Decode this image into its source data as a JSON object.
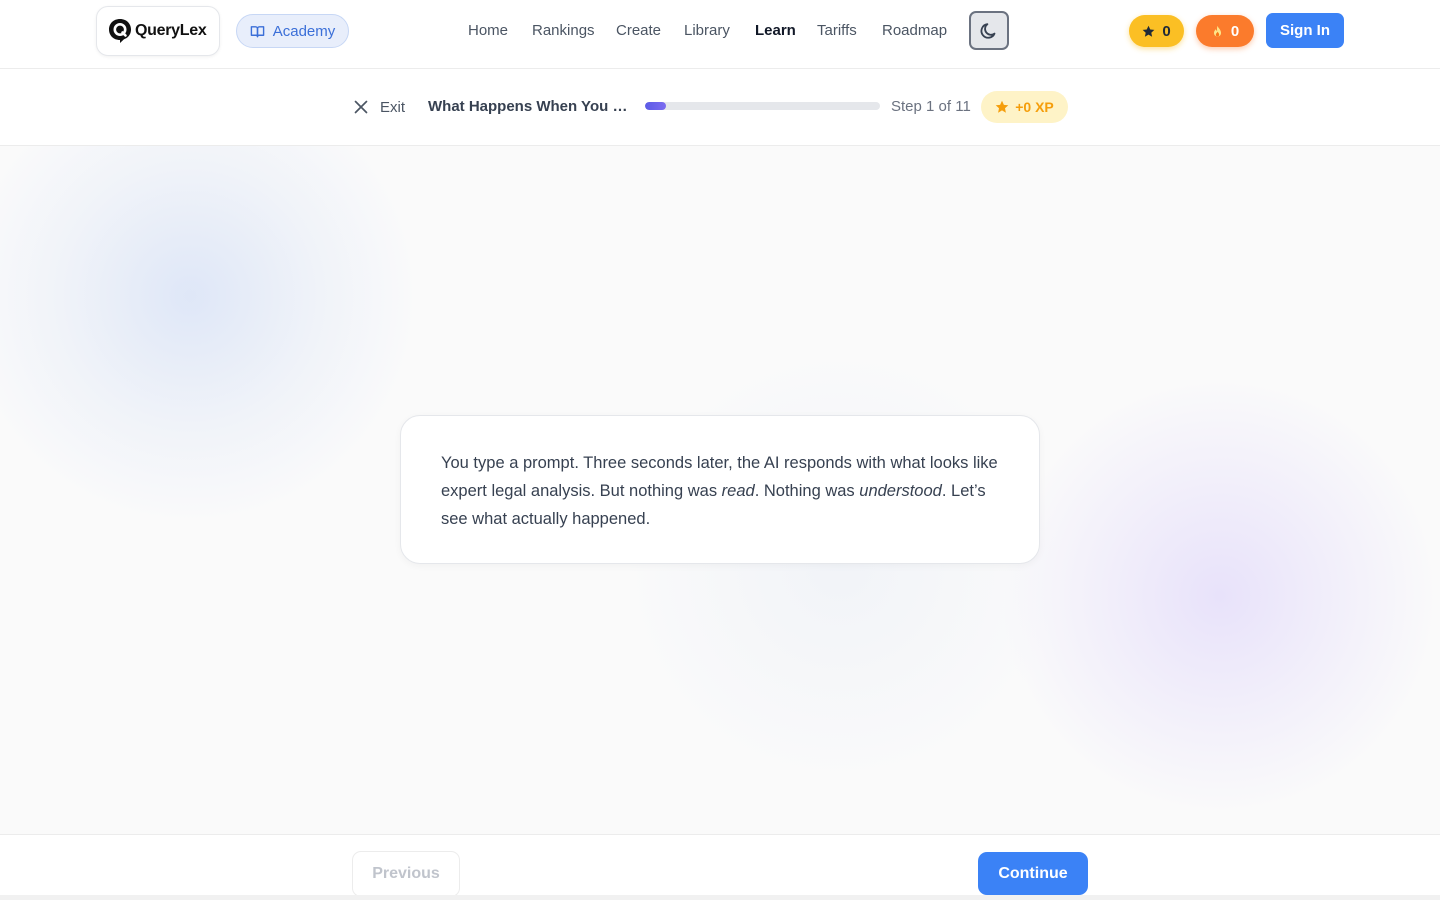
{
  "brand": {
    "name": "QueryLex",
    "logo_icon": "chat-bubble-q-icon"
  },
  "header": {
    "academy_label": "Academy",
    "nav": [
      {
        "label": "Home",
        "active": false
      },
      {
        "label": "Rankings",
        "active": false
      },
      {
        "label": "Create",
        "active": false
      },
      {
        "label": "Library",
        "active": false
      },
      {
        "label": "Learn",
        "active": true
      },
      {
        "label": "Tariffs",
        "active": false
      },
      {
        "label": "Roadmap",
        "active": false
      }
    ],
    "theme_icon": "moon-icon",
    "stars_count": "0",
    "streak_count": "0",
    "signin_label": "Sign In"
  },
  "lesson": {
    "exit_label": "Exit",
    "title": "What Happens When You T...",
    "progress_fraction": 0.09,
    "step_label": "Step 1 of 11",
    "xp_label": "+0 XP",
    "body_part1": "You type a prompt. Three seconds later, the AI responds with what looks like expert legal analysis. But nothing was ",
    "body_em1": "read",
    "body_part2": ". Nothing was ",
    "body_em2": "understood",
    "body_part3": ". Let’s see what actually happened."
  },
  "footer": {
    "previous_label": "Previous",
    "continue_label": "Continue"
  },
  "colors": {
    "accent": "#3b82f6",
    "progress": "#5b5be6",
    "star_badge": "#fbbf24",
    "streak_badge": "#fb7b2c",
    "xp_text": "#f59e0b"
  }
}
